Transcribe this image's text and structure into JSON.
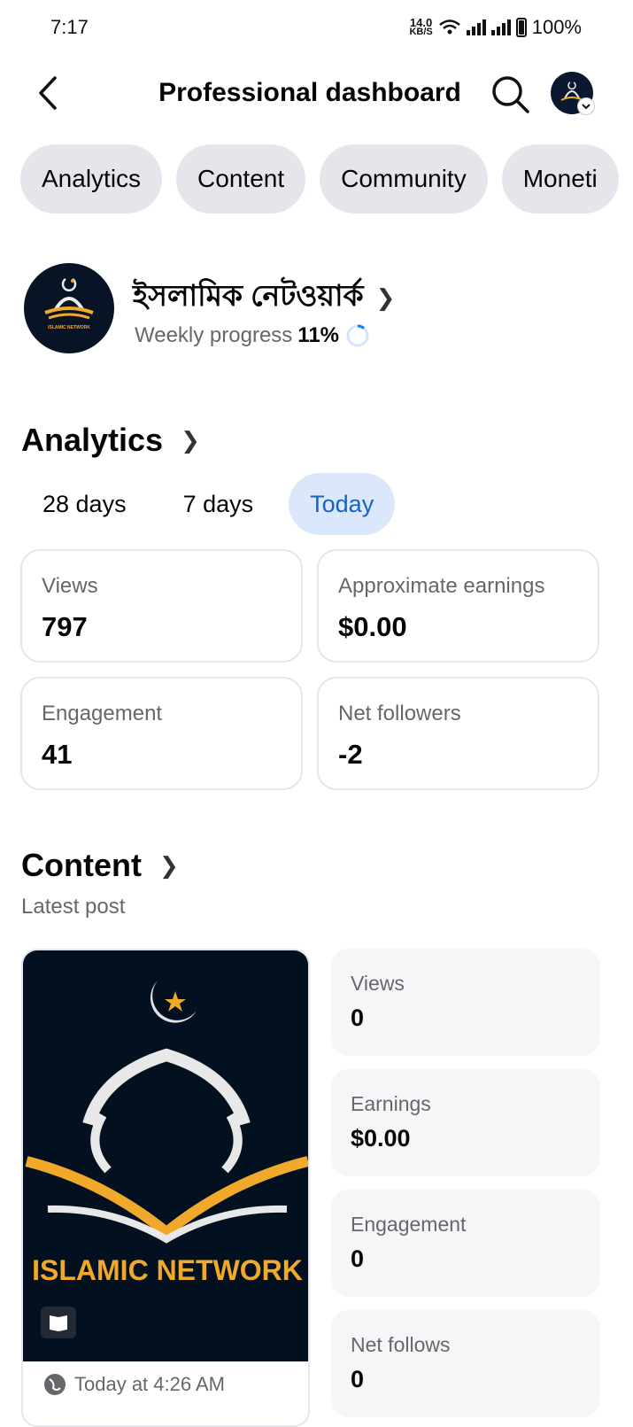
{
  "status_bar": {
    "time": "7:17",
    "net_speed_value": "14.0",
    "net_speed_unit": "KB/S",
    "battery": "100%"
  },
  "header": {
    "title": "Professional dashboard",
    "back_icon": "back-arrow-icon",
    "search_icon": "search-icon"
  },
  "tabs": [
    "Analytics",
    "Content",
    "Community",
    "Moneti"
  ],
  "profile": {
    "name": "ইসলামিক নেটওয়ার্ক",
    "logo_text": "ISLAMIC NETWORK",
    "weekly_label": "Weekly progress",
    "weekly_value": "11%",
    "weekly_progress": 0.11
  },
  "analytics": {
    "title": "Analytics",
    "ranges": [
      "28 days",
      "7 days",
      "Today"
    ],
    "selected_range": "Today",
    "stats": [
      {
        "label": "Views",
        "value": "797"
      },
      {
        "label": "Approximate earnings",
        "value": "$0.00"
      },
      {
        "label": "Engagement",
        "value": "41"
      },
      {
        "label": "Net followers",
        "value": "-2"
      }
    ]
  },
  "content": {
    "title": "Content",
    "subtitle": "Latest post",
    "post": {
      "image_text": "ISLAMIC NETWORK",
      "time": "Today at 4:26 AM"
    },
    "stats": [
      {
        "label": "Views",
        "value": "0"
      },
      {
        "label": "Earnings",
        "value": "$0.00"
      },
      {
        "label": "Engagement",
        "value": "0"
      },
      {
        "label": "Net follows",
        "value": "0"
      }
    ]
  },
  "colors": {
    "accent": "#1762c4",
    "accent_bg": "#dbe7fb",
    "pill_bg": "#e4e6eb",
    "logo_bg": "#081426",
    "gold": "#f0a92a"
  }
}
